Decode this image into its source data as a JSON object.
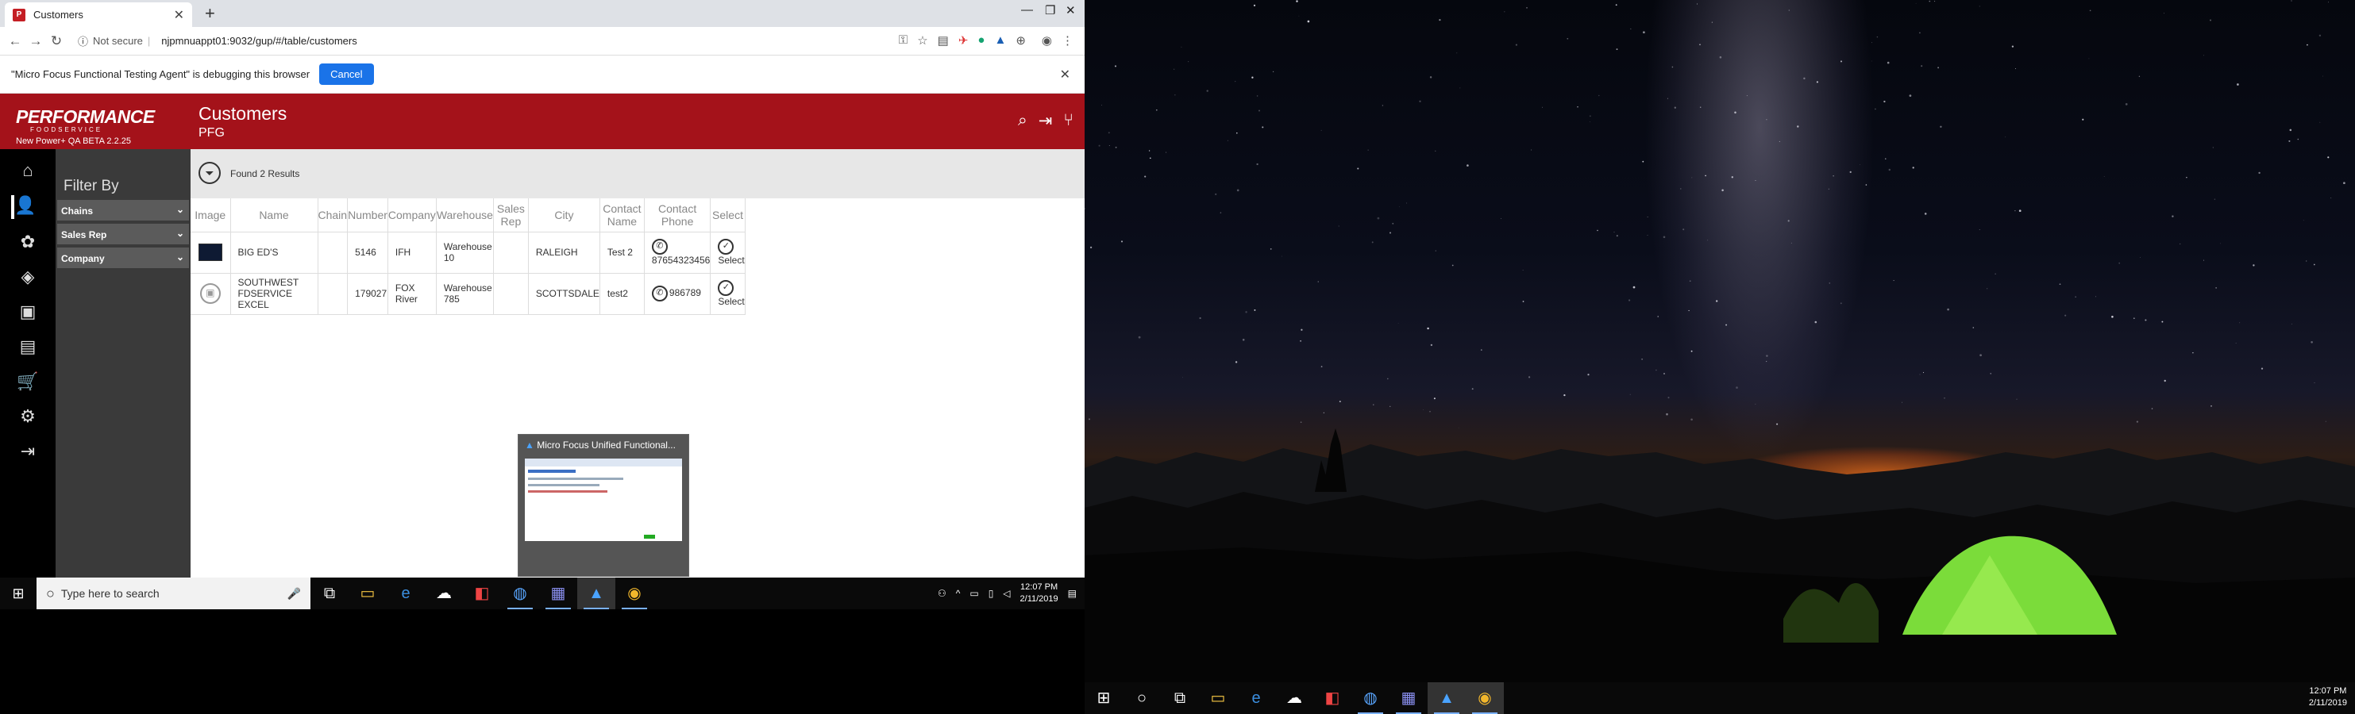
{
  "browser": {
    "tab_title": "Customers",
    "new_tab_label": "+",
    "not_secure": "Not secure",
    "url": "njpmnuappt01:9032/gup/#/table/customers",
    "debug_message": "\"Micro Focus Functional Testing Agent\" is debugging this browser",
    "debug_cancel": "Cancel"
  },
  "app": {
    "brand": "PERFORMANCE",
    "brand_sub": "FOODSERVICE",
    "version": "New Power+ QA BETA 2.2.25",
    "page_title": "Customers",
    "page_subtitle": "PFG",
    "filter_title": "Filter By",
    "filters": [
      "Chains",
      "Sales Rep",
      "Company"
    ],
    "result_count": "Found 2 Results"
  },
  "table": {
    "headers": [
      "Image",
      "Name",
      "Chain",
      "Number",
      "Company",
      "Warehouse",
      "Sales Rep",
      "City",
      "Contact Name",
      "Contact Phone",
      "Select"
    ],
    "rows": [
      {
        "name": "BIG ED'S",
        "chain": "",
        "number": "5146",
        "company": "IFH",
        "warehouse": "Warehouse 10",
        "sales_rep": "",
        "city": "RALEIGH",
        "contact_name": "Test 2",
        "contact_phone": "87654323456",
        "select": "Select"
      },
      {
        "name": "SOUTHWEST FDSERVICE EXCEL",
        "chain": "",
        "number": "179027",
        "company": "FOX River",
        "warehouse": "Warehouse 785",
        "sales_rep": "",
        "city": "SCOTTSDALE",
        "contact_name": "test2",
        "contact_phone": "986789",
        "select": "Select"
      }
    ]
  },
  "thumbnail": {
    "title": "Micro Focus Unified Functional..."
  },
  "taskbar": {
    "search_placeholder": "Type here to search",
    "time": "12:07 PM",
    "date": "2/11/2019"
  },
  "colors": {
    "brand_red": "#a4121a",
    "chrome_blue": "#1a73e8"
  }
}
